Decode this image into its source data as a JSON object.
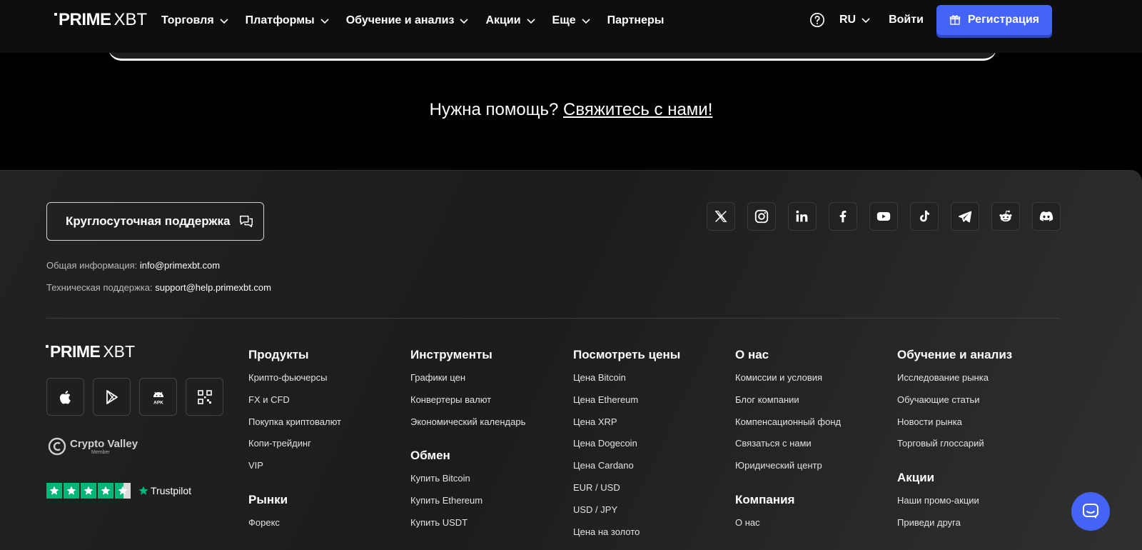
{
  "brand": {
    "bold": "PRIME",
    "light": "XBT"
  },
  "nav": {
    "items": [
      {
        "label": "Торговля",
        "dropdown": true
      },
      {
        "label": "Платформы",
        "dropdown": true
      },
      {
        "label": "Обучение и анализ",
        "dropdown": true
      },
      {
        "label": "Акции",
        "dropdown": true
      },
      {
        "label": "Еще",
        "dropdown": true
      },
      {
        "label": "Партнеры",
        "dropdown": false
      }
    ],
    "lang": "RU",
    "login": "Войти",
    "register": "Регистрация"
  },
  "help": {
    "text": "Нужна помощь?",
    "link": "Свяжитесь с нами!"
  },
  "footer": {
    "support_button": "Круглосуточная поддержка",
    "contacts": [
      {
        "label": "Общая информация:",
        "value": "info@primexbt.com"
      },
      {
        "label": "Техническая поддержка:",
        "value": "support@help.primexbt.com"
      }
    ],
    "socials": [
      "x-icon",
      "instagram-icon",
      "linkedin-icon",
      "facebook-icon",
      "youtube-icon",
      "tiktok-icon",
      "telegram-icon",
      "reddit-icon",
      "discord-icon"
    ],
    "apps": [
      "apple-icon",
      "google-play-icon",
      "apk-icon",
      "qr-code-icon"
    ],
    "apk_label": "APK",
    "crypto_valley": {
      "title": "Crypto Valley",
      "sub": "Member"
    },
    "trustpilot": "Trustpilot",
    "columns": [
      {
        "title": "Продукты",
        "links": [
          "Крипто-фьючерсы",
          "FX и CFD",
          "Покупка криптовалют",
          "Копи-трейдинг",
          "VIP"
        ],
        "title2": "Рынки",
        "links2": [
          "Форекс"
        ]
      },
      {
        "title": "Инструменты",
        "links": [
          "Графики цен",
          "Конвертеры валют",
          "Экономический календарь"
        ],
        "title2": "Обмен",
        "links2": [
          "Купить Bitcoin",
          "Купить Ethereum",
          "Купить USDT"
        ]
      },
      {
        "title": "Посмотреть цены",
        "links": [
          "Цена Bitcoin",
          "Цена Ethereum",
          "Цена XRP",
          "Цена Dogecoin",
          "Цена Cardano",
          "EUR / USD",
          "USD / JPY",
          "Цена на золото"
        ]
      },
      {
        "title": "О нас",
        "links": [
          "Комиссии и условия",
          "Блог компании",
          "Компенсационный фонд",
          "Связаться с нами",
          "Юридический центр"
        ],
        "title2": "Компания",
        "links2": [
          "О нас"
        ]
      },
      {
        "title": "Обучение и анализ",
        "links": [
          "Исследование рынка",
          "Обучающие статьи",
          "Новости рынка",
          "Торговый глоссарий"
        ],
        "title2": "Акции",
        "links2": [
          "Наши промо-акции",
          "Приведи друга"
        ]
      }
    ]
  },
  "colors": {
    "accent": "#4364f7",
    "trustpilot": "#00b67a"
  }
}
